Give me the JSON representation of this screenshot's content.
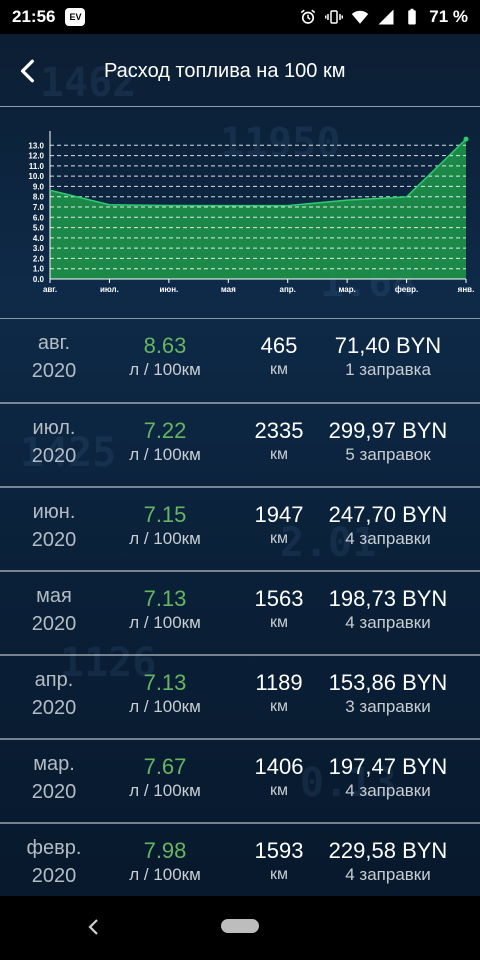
{
  "status": {
    "time": "21:56",
    "app_badge": "EV",
    "battery": "71 %"
  },
  "app_bar": {
    "title": "Расход топлива на 100 км",
    "back_icon": "back-arrow-icon"
  },
  "colors": {
    "accent_green": "#66b561",
    "area_fill": "#1f9a4a",
    "area_line": "#2ecc71"
  },
  "chart_data": {
    "type": "area",
    "categories": [
      "авг.",
      "июл.",
      "июн.",
      "мая",
      "апр.",
      "мар.",
      "февр.",
      "янв."
    ],
    "values": [
      8.63,
      7.22,
      7.15,
      7.13,
      7.13,
      7.67,
      7.98,
      13.6
    ],
    "yticks": [
      "0.0",
      "1.0",
      "2.0",
      "3.0",
      "4.0",
      "5.0",
      "6.0",
      "7.0",
      "8.0",
      "9.0",
      "10.0",
      "11.0",
      "12.0",
      "13.0"
    ],
    "ylim": [
      0,
      14
    ],
    "grid": "dashed horizontal"
  },
  "rows": [
    {
      "month": "авг.",
      "year": "2020",
      "consumption": "8.63",
      "cons_unit": "л / 100км",
      "km": "465",
      "km_unit": "км",
      "cost": "71,40 BYN",
      "refuels": "1 заправка"
    },
    {
      "month": "июл.",
      "year": "2020",
      "consumption": "7.22",
      "cons_unit": "л / 100км",
      "km": "2335",
      "km_unit": "км",
      "cost": "299,97 BYN",
      "refuels": "5 заправок"
    },
    {
      "month": "июн.",
      "year": "2020",
      "consumption": "7.15",
      "cons_unit": "л / 100км",
      "km": "1947",
      "km_unit": "км",
      "cost": "247,70 BYN",
      "refuels": "4 заправки"
    },
    {
      "month": "мая",
      "year": "2020",
      "consumption": "7.13",
      "cons_unit": "л / 100км",
      "km": "1563",
      "km_unit": "км",
      "cost": "198,73 BYN",
      "refuels": "4 заправки"
    },
    {
      "month": "апр.",
      "year": "2020",
      "consumption": "7.13",
      "cons_unit": "л / 100км",
      "km": "1189",
      "km_unit": "км",
      "cost": "153,86 BYN",
      "refuels": "3 заправки"
    },
    {
      "month": "мар.",
      "year": "2020",
      "consumption": "7.67",
      "cons_unit": "л / 100км",
      "km": "1406",
      "km_unit": "км",
      "cost": "197,47 BYN",
      "refuels": "4 заправки"
    },
    {
      "month": "февр.",
      "year": "2020",
      "consumption": "7.98",
      "cons_unit": "л / 100км",
      "km": "1593",
      "km_unit": "км",
      "cost": "229,58 BYN",
      "refuels": "4 заправки"
    }
  ]
}
